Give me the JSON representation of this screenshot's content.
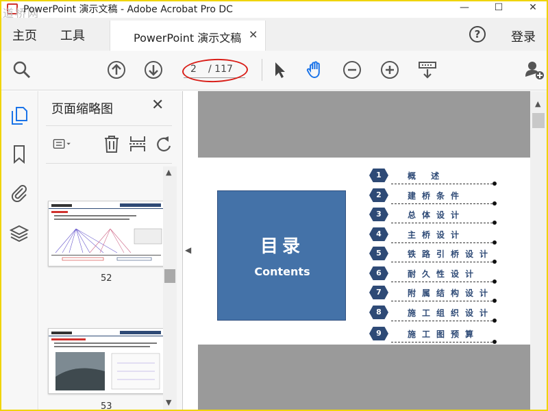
{
  "window": {
    "title": "PowerPoint 演示文稿 - Adobe Acrobat Pro DC",
    "watermark": "道桥网",
    "minimize": "—",
    "maximize": "☐",
    "close": "✕"
  },
  "menu": {
    "home": "主页",
    "tools": "工具",
    "help": "?",
    "login": "登录"
  },
  "tab": {
    "label": "PowerPoint 演示文稿",
    "close": "✕"
  },
  "toolbar": {
    "current_page": "2",
    "total_pages": "/ 117",
    "icons": [
      "search-icon",
      "page-up-icon",
      "page-down-icon",
      "select-arrow-icon",
      "hand-icon",
      "zoom-out-icon",
      "zoom-in-icon",
      "scroll-mode-icon",
      "share-user-icon"
    ]
  },
  "sidebar": {
    "panel_title": "页面缩略图",
    "close": "✕",
    "thumbnails": [
      {
        "page": "52"
      },
      {
        "page": "53"
      }
    ]
  },
  "slide": {
    "heading": "目录",
    "subheading": "Contents",
    "toc": [
      {
        "num": "1",
        "text": "概        述"
      },
      {
        "num": "2",
        "text": "建桥条件"
      },
      {
        "num": "3",
        "text": "总体设计"
      },
      {
        "num": "4",
        "text": "主桥设计"
      },
      {
        "num": "5",
        "text": "铁路引桥设计"
      },
      {
        "num": "6",
        "text": "耐久性设计"
      },
      {
        "num": "7",
        "text": "附属结构设计"
      },
      {
        "num": "8",
        "text": "施工组织设计"
      },
      {
        "num": "9",
        "text": "施工图预算"
      }
    ]
  },
  "colors": {
    "accent": "#2e4a76",
    "slide_box": "#4472a8",
    "annotation": "#d91e18",
    "highlight": "#1a73e8"
  }
}
